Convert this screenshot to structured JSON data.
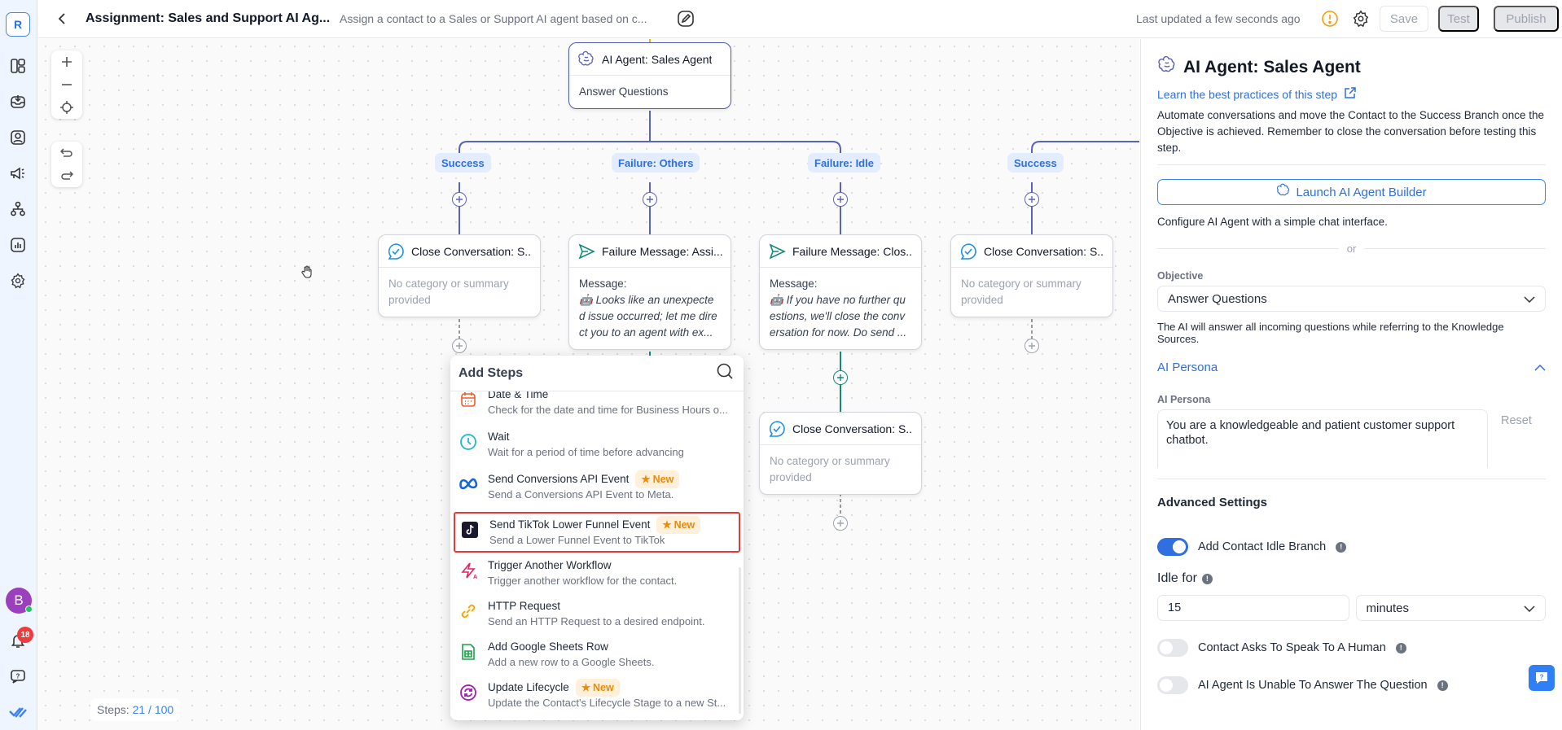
{
  "rail": {
    "logo": "R",
    "items": [
      {
        "name": "dashboard-icon"
      },
      {
        "name": "inbox-icon"
      },
      {
        "name": "contacts-icon"
      },
      {
        "name": "broadcast-icon"
      },
      {
        "name": "workflows-icon"
      },
      {
        "name": "reports-icon"
      },
      {
        "name": "settings-icon"
      }
    ],
    "avatar_initial": "B",
    "notifications_count": "18"
  },
  "header": {
    "title": "Assignment: Sales and Support AI Ag...",
    "description": "Assign a contact to a Sales or Support AI agent based on c...",
    "last_updated": "Last updated a few seconds ago",
    "save_label": "Save",
    "test_label": "Test",
    "publish_label": "Publish"
  },
  "canvas": {
    "steps_label": "Steps:",
    "steps_value": "21 / 100",
    "main_node": {
      "title": "AI Agent: Sales Agent",
      "body": "Answer Questions"
    },
    "branches": [
      {
        "label": "Success"
      },
      {
        "label": "Failure: Others"
      },
      {
        "label": "Failure: Idle"
      },
      {
        "label": "Success"
      }
    ],
    "nodes": [
      {
        "title": "Close Conversation: S...",
        "body": "No category or summary provided"
      },
      {
        "title": "Failure Message: Assi...",
        "body_label": "Message:",
        "body": "Looks like an unexpecte d issue occurred; let me dire ct you to an agent with ex..."
      },
      {
        "title": "Failure Message: Clos...",
        "body_label": "Message:",
        "body": "If you have no further qu estions, we'll close the conv ersation for now. Do send ..."
      },
      {
        "title": "Close Conversation: S...",
        "body": "No category or summary provided"
      },
      {
        "title": "Close Conversation: S...",
        "body": "No category or summary provided"
      }
    ]
  },
  "add_steps": {
    "title": "Add Steps",
    "new_label": "New",
    "items": [
      {
        "title": "Date & Time",
        "desc": "Check for the date and time for Business Hours o...",
        "icon": "calendar-icon",
        "new": false
      },
      {
        "title": "Wait",
        "desc": "Wait for a period of time before advancing",
        "icon": "clock-icon",
        "new": false
      },
      {
        "title": "Send Conversions API Event",
        "desc": "Send a Conversions API Event to Meta.",
        "icon": "meta-icon",
        "new": true
      },
      {
        "title": "Send TikTok Lower Funnel Event",
        "desc": "Send a Lower Funnel Event to TikTok",
        "icon": "tiktok-icon",
        "new": true,
        "highlighted": true
      },
      {
        "title": "Trigger Another Workflow",
        "desc": "Trigger another workflow for the contact.",
        "icon": "trigger-workflow-icon",
        "new": false
      },
      {
        "title": "HTTP Request",
        "desc": "Send an HTTP Request to a desired endpoint.",
        "icon": "http-request-icon",
        "new": false
      },
      {
        "title": "Add Google Sheets Row",
        "desc": "Add a new row to a Google Sheets.",
        "icon": "google-sheets-icon",
        "new": false
      },
      {
        "title": "Update Lifecycle",
        "desc": "Update the Contact's Lifecycle Stage to a new St...",
        "icon": "lifecycle-icon",
        "new": true
      }
    ]
  },
  "panel": {
    "title": "AI Agent: Sales Agent",
    "learn_link": "Learn the best practices of this step",
    "description": "Automate conversations and move the Contact to the Success Branch once the Objective is achieved. Remember to close the conversation before testing this step.",
    "launch_button": "Launch AI Agent Builder",
    "configure_note": "Configure AI Agent with a simple chat interface.",
    "or": "or",
    "objective_label": "Objective",
    "objective_value": "Answer Questions",
    "objective_note": "The AI will answer all incoming questions while referring to the Knowledge Sources.",
    "persona_section": "AI Persona",
    "persona_label": "AI Persona",
    "persona_value": "You are a knowledgeable and patient customer support chatbot.",
    "reset_label": "Reset",
    "advanced_title": "Advanced Settings",
    "toggle_idle": {
      "label": "Add Contact Idle Branch",
      "on": true
    },
    "idle_for_label": "Idle for",
    "idle_value": "15",
    "idle_unit": "minutes",
    "toggle_human": {
      "label": "Contact Asks To Speak To A Human",
      "on": false
    },
    "toggle_unable": {
      "label": "AI Agent Is Unable To Answer The Question",
      "on": false
    }
  },
  "colors": {
    "accent": "#2f6fe0",
    "wire_main": "#5a63b8",
    "wire_teal": "#118a79",
    "highlight": "#e53935",
    "new_badge": "#f08a00"
  }
}
